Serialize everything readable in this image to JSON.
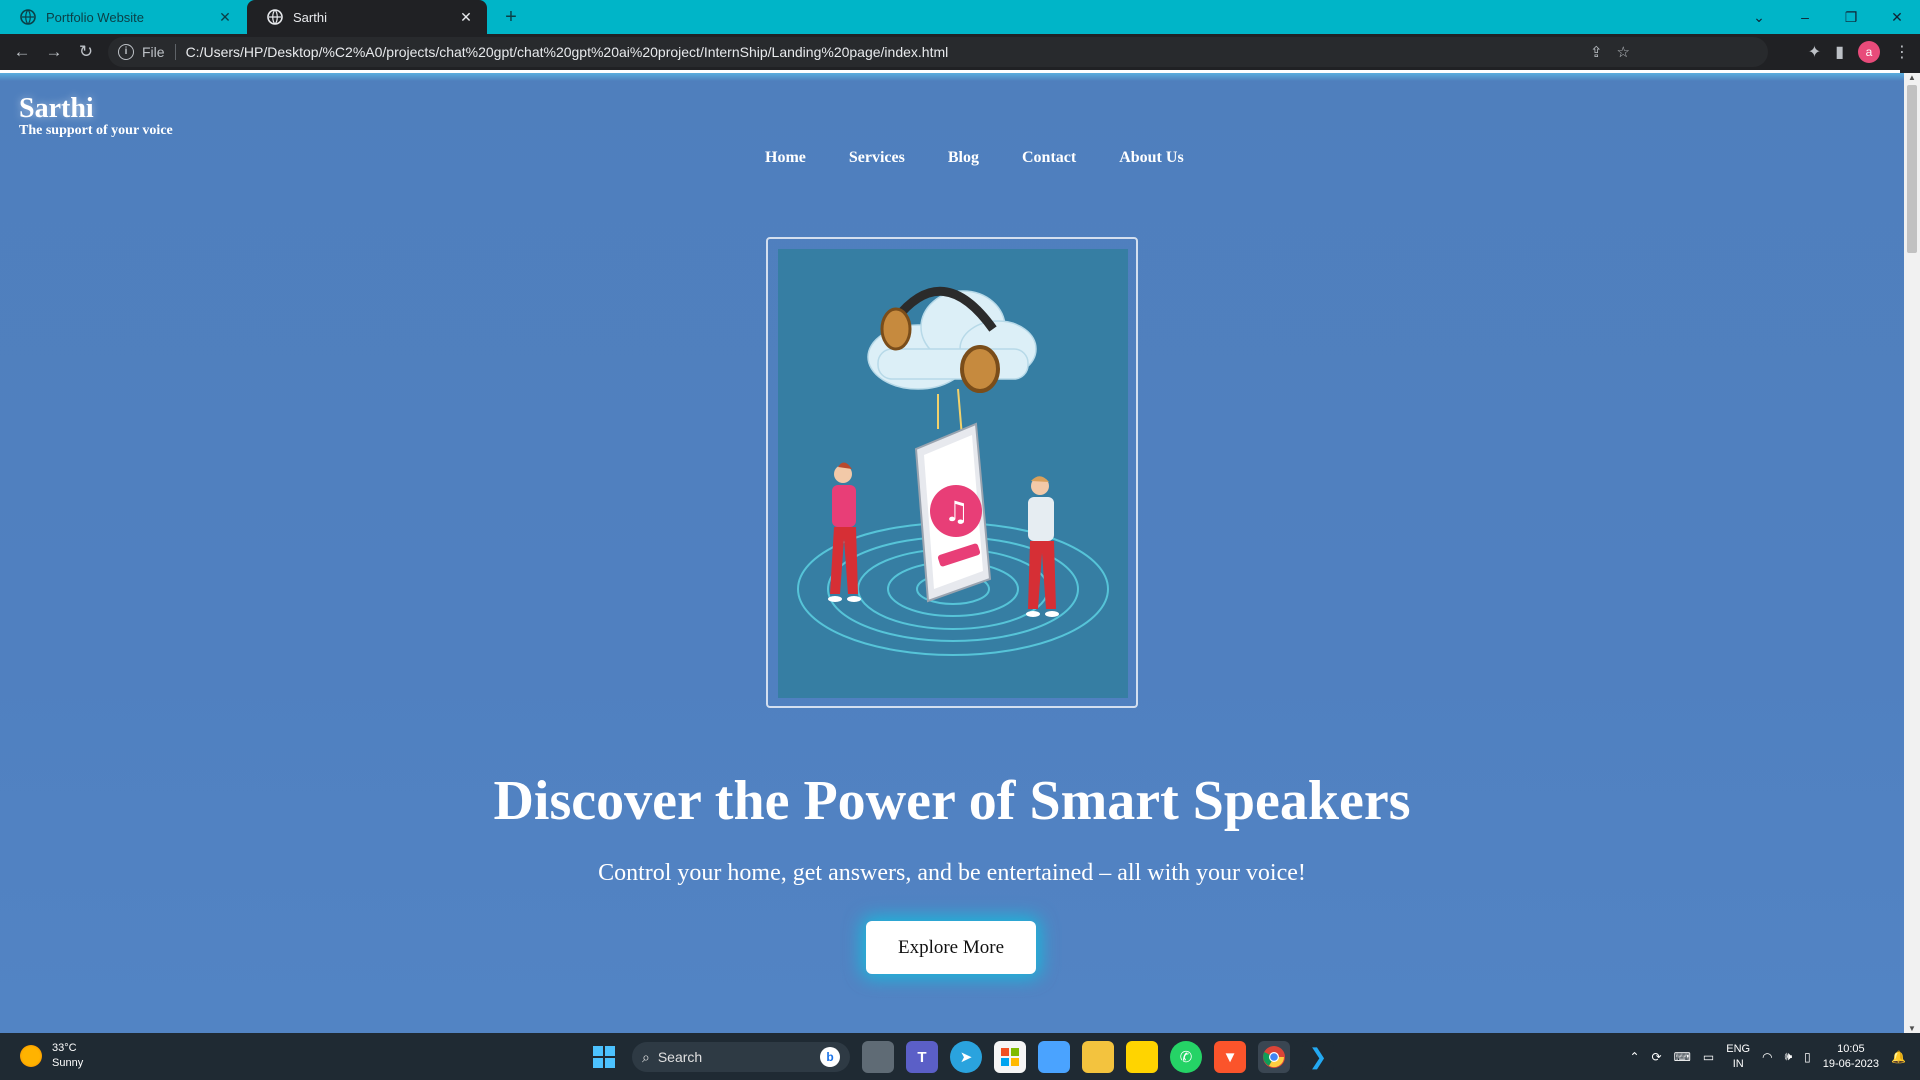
{
  "browser": {
    "tabs": [
      {
        "title": "Portfolio Website",
        "active": false
      },
      {
        "title": "Sarthi",
        "active": true
      }
    ],
    "new_tab_label": "+",
    "address": {
      "scheme_label": "File",
      "url": "C:/Users/HP/Desktop/%C2%A0/projects/chat%20gpt/chat%20gpt%20ai%20project/InternShip/Landing%20page/index.html"
    },
    "profile_initial": "a",
    "window_controls": [
      "⌄",
      "–",
      "❐",
      "✕"
    ]
  },
  "page": {
    "brand": {
      "name": "Sarthi",
      "tagline": "The support of your voice"
    },
    "nav": [
      "Home",
      "Services",
      "Blog",
      "Contact",
      "About Us"
    ],
    "headline": "Discover the Power of Smart Speakers",
    "subline": "Control your home, get answers, and be entertained – all with your voice!",
    "cta_label": "Explore More",
    "colors": {
      "background": "#5080c0",
      "hero_image_bg": "#367ea3",
      "cta_glow": "#00d2e6"
    }
  },
  "taskbar": {
    "weather": {
      "temp": "33°C",
      "condition": "Sunny"
    },
    "search_label": "Search",
    "apps": [
      "start-icon",
      "search",
      "task-view-icon",
      "teams-icon",
      "telegram-icon",
      "microsoft-store-icon",
      "notepad-icon",
      "file-explorer-icon",
      "sticky-notes-icon",
      "whatsapp-icon",
      "brave-icon",
      "chrome-icon",
      "vscode-icon"
    ],
    "tray": {
      "language": "ENG",
      "region": "IN",
      "time": "10:05",
      "date": "19-06-2023"
    }
  }
}
